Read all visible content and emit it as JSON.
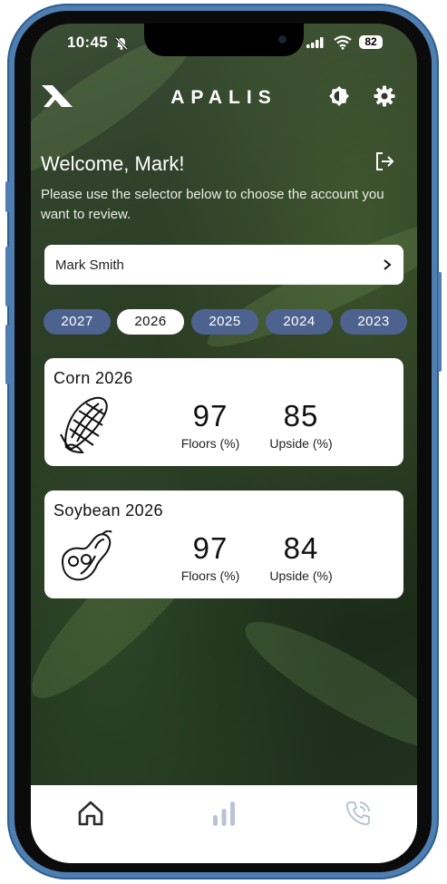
{
  "status_bar": {
    "time": "10:45",
    "battery": "82"
  },
  "header": {
    "app_title": "APALIS"
  },
  "welcome": {
    "heading": "Welcome, Mark!",
    "instructions": "Please use the selector below to choose the account you want to review."
  },
  "account_selector": {
    "value": "Mark Smith"
  },
  "years": [
    {
      "label": "2027",
      "selected": false
    },
    {
      "label": "2026",
      "selected": true
    },
    {
      "label": "2025",
      "selected": false
    },
    {
      "label": "2024",
      "selected": false
    },
    {
      "label": "2023",
      "selected": false
    }
  ],
  "cards": [
    {
      "title": "Corn 2026",
      "icon": "corn-icon",
      "floors_value": "97",
      "floors_label": "Floors (%)",
      "upside_value": "85",
      "upside_label": "Upside (%)"
    },
    {
      "title": "Soybean 2026",
      "icon": "soybean-icon",
      "floors_value": "97",
      "floors_label": "Floors (%)",
      "upside_value": "84",
      "upside_label": "Upside (%)"
    }
  ],
  "tabs": [
    {
      "name": "home",
      "icon": "home-icon",
      "active": true
    },
    {
      "name": "charts",
      "icon": "bar-chart-icon",
      "active": false
    },
    {
      "name": "contact",
      "icon": "phone-icon",
      "active": false
    }
  ],
  "colors": {
    "year_pill": "#4d628f",
    "frame": "#4f7fb0",
    "active_tab": "#2b2b2b",
    "inactive_tab": "#b8c4d6"
  }
}
